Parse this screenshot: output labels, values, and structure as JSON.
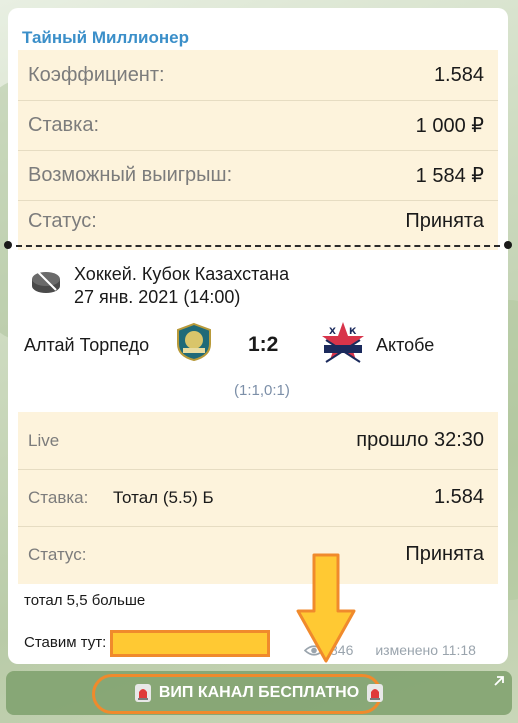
{
  "channel": {
    "name": "Тайный Миллионер"
  },
  "bet_summary": {
    "rows": [
      {
        "label": "Коэффициент:",
        "value": "1.584"
      },
      {
        "label": "Ставка:",
        "value": "1 000 ₽"
      },
      {
        "label": "Возможный выигрыш:",
        "value": "1 584 ₽"
      },
      {
        "label": "Статус:",
        "value": "Принята"
      }
    ]
  },
  "match": {
    "sport_icon": "hockey-puck-icon",
    "league": "Хоккей. Кубок Казахстана",
    "date": "27 янв. 2021 (14:00)",
    "team_home": "Алтай Торпедо",
    "team_away": "Актобе",
    "score": "1:2",
    "periods": "(1:1,0:1)"
  },
  "live": {
    "label": "Live",
    "value": "прошло 32:30"
  },
  "selection": {
    "bet_label": "Ставка:",
    "market": "Тотал (5.5) Б",
    "odds": "1.584",
    "status_label": "Статус:",
    "status_value": "Принята"
  },
  "post": {
    "note": "тотал 5,5 больше",
    "place_here": "Ставим тут:",
    "views": "846",
    "edited": "изменено 11:18"
  },
  "button": {
    "label": "ВИП КАНАЛ БЕСПЛАТНО",
    "icon": "siren-icon"
  },
  "colors": {
    "channel_name": "#3b8fc9",
    "slip_bg": "#fdf3dc",
    "highlight": "#ffc933",
    "outline": "#f08a2c",
    "button_bg": "#7ea06c"
  }
}
